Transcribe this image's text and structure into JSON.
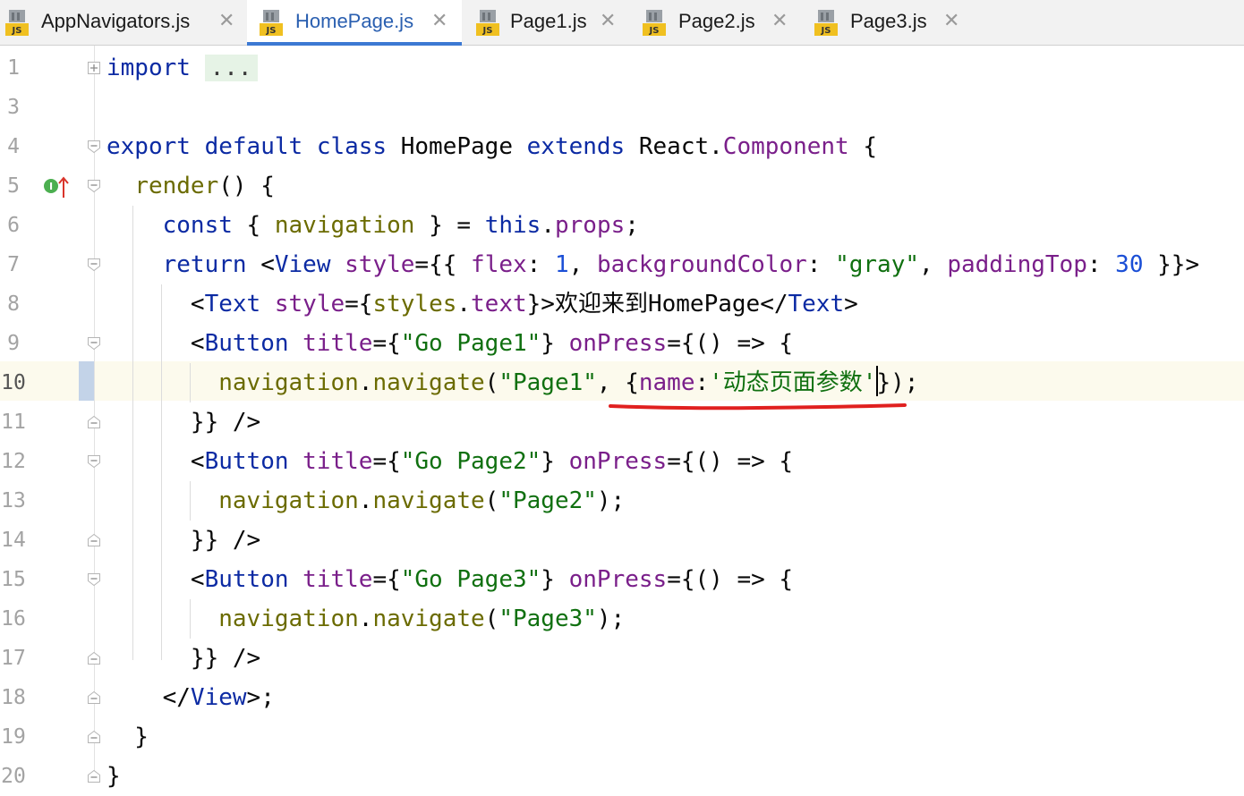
{
  "tabs": [
    {
      "label": "AppNavigators.js",
      "active": false,
      "icon": "js-file-icon"
    },
    {
      "label": "HomePage.js",
      "active": true,
      "icon": "js-file-icon"
    },
    {
      "label": "Page1.js",
      "active": false,
      "icon": "js-file-icon"
    },
    {
      "label": "Page2.js",
      "active": false,
      "icon": "js-file-icon"
    },
    {
      "label": "Page3.js",
      "active": false,
      "icon": "js-file-icon"
    }
  ],
  "file_icon_badge": "JS",
  "close_glyph": "✕",
  "line_numbers": [
    "1",
    "3",
    "4",
    "5",
    "6",
    "7",
    "8",
    "9",
    "10",
    "11",
    "12",
    "13",
    "14",
    "15",
    "16",
    "17",
    "18",
    "19",
    "20"
  ],
  "current_line": "10",
  "code_lines": [
    "import ...",
    "",
    "export default class HomePage extends React.Component {",
    "  render() {",
    "    const { navigation } = this.props;",
    "    return <View style={{ flex: 1, backgroundColor: \"gray\", paddingTop: 30 }}>",
    "      <Text style={styles.text}>欢迎来到HomePage</Text>",
    "      <Button title={\"Go Page1\"} onPress={() => {",
    "        navigation.navigate(\"Page1\", {name:'动态页面参数'});",
    "      }} />",
    "      <Button title={\"Go Page2\"} onPress={() => {",
    "        navigation.navigate(\"Page2\");",
    "      }} />",
    "      <Button title={\"Go Page3\"} onPress={() => {",
    "        navigation.navigate(\"Page3\");",
    "      }} />",
    "    </View>;",
    "  }",
    "}"
  ],
  "colors": {
    "keyword": "#0b2aa3",
    "string": "#107010",
    "property": "#7a1f8a",
    "function": "#6b6b00",
    "number": "#1b4fd6",
    "annotation_underline": "#e02020",
    "active_tab_underline": "#3c79d3"
  },
  "gutter_icons": {
    "override_marker": "implemented-override-icon",
    "fold": "fold-marker-icon"
  }
}
